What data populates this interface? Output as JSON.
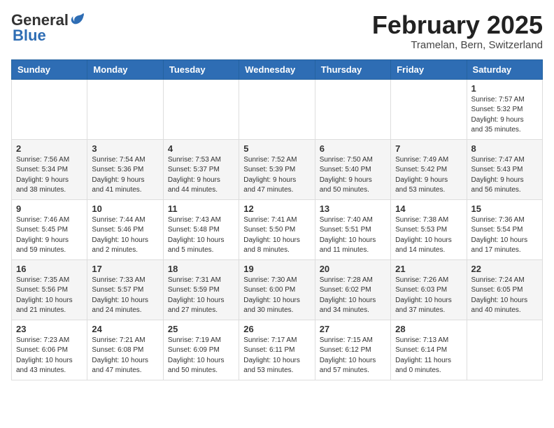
{
  "header": {
    "logo_general": "General",
    "logo_blue": "Blue",
    "month_title": "February 2025",
    "location": "Tramelan, Bern, Switzerland"
  },
  "weekdays": [
    "Sunday",
    "Monday",
    "Tuesday",
    "Wednesday",
    "Thursday",
    "Friday",
    "Saturday"
  ],
  "weeks": [
    [
      {
        "day": "",
        "info": ""
      },
      {
        "day": "",
        "info": ""
      },
      {
        "day": "",
        "info": ""
      },
      {
        "day": "",
        "info": ""
      },
      {
        "day": "",
        "info": ""
      },
      {
        "day": "",
        "info": ""
      },
      {
        "day": "1",
        "info": "Sunrise: 7:57 AM\nSunset: 5:32 PM\nDaylight: 9 hours\nand 35 minutes."
      }
    ],
    [
      {
        "day": "2",
        "info": "Sunrise: 7:56 AM\nSunset: 5:34 PM\nDaylight: 9 hours\nand 38 minutes."
      },
      {
        "day": "3",
        "info": "Sunrise: 7:54 AM\nSunset: 5:36 PM\nDaylight: 9 hours\nand 41 minutes."
      },
      {
        "day": "4",
        "info": "Sunrise: 7:53 AM\nSunset: 5:37 PM\nDaylight: 9 hours\nand 44 minutes."
      },
      {
        "day": "5",
        "info": "Sunrise: 7:52 AM\nSunset: 5:39 PM\nDaylight: 9 hours\nand 47 minutes."
      },
      {
        "day": "6",
        "info": "Sunrise: 7:50 AM\nSunset: 5:40 PM\nDaylight: 9 hours\nand 50 minutes."
      },
      {
        "day": "7",
        "info": "Sunrise: 7:49 AM\nSunset: 5:42 PM\nDaylight: 9 hours\nand 53 minutes."
      },
      {
        "day": "8",
        "info": "Sunrise: 7:47 AM\nSunset: 5:43 PM\nDaylight: 9 hours\nand 56 minutes."
      }
    ],
    [
      {
        "day": "9",
        "info": "Sunrise: 7:46 AM\nSunset: 5:45 PM\nDaylight: 9 hours\nand 59 minutes."
      },
      {
        "day": "10",
        "info": "Sunrise: 7:44 AM\nSunset: 5:46 PM\nDaylight: 10 hours\nand 2 minutes."
      },
      {
        "day": "11",
        "info": "Sunrise: 7:43 AM\nSunset: 5:48 PM\nDaylight: 10 hours\nand 5 minutes."
      },
      {
        "day": "12",
        "info": "Sunrise: 7:41 AM\nSunset: 5:50 PM\nDaylight: 10 hours\nand 8 minutes."
      },
      {
        "day": "13",
        "info": "Sunrise: 7:40 AM\nSunset: 5:51 PM\nDaylight: 10 hours\nand 11 minutes."
      },
      {
        "day": "14",
        "info": "Sunrise: 7:38 AM\nSunset: 5:53 PM\nDaylight: 10 hours\nand 14 minutes."
      },
      {
        "day": "15",
        "info": "Sunrise: 7:36 AM\nSunset: 5:54 PM\nDaylight: 10 hours\nand 17 minutes."
      }
    ],
    [
      {
        "day": "16",
        "info": "Sunrise: 7:35 AM\nSunset: 5:56 PM\nDaylight: 10 hours\nand 21 minutes."
      },
      {
        "day": "17",
        "info": "Sunrise: 7:33 AM\nSunset: 5:57 PM\nDaylight: 10 hours\nand 24 minutes."
      },
      {
        "day": "18",
        "info": "Sunrise: 7:31 AM\nSunset: 5:59 PM\nDaylight: 10 hours\nand 27 minutes."
      },
      {
        "day": "19",
        "info": "Sunrise: 7:30 AM\nSunset: 6:00 PM\nDaylight: 10 hours\nand 30 minutes."
      },
      {
        "day": "20",
        "info": "Sunrise: 7:28 AM\nSunset: 6:02 PM\nDaylight: 10 hours\nand 34 minutes."
      },
      {
        "day": "21",
        "info": "Sunrise: 7:26 AM\nSunset: 6:03 PM\nDaylight: 10 hours\nand 37 minutes."
      },
      {
        "day": "22",
        "info": "Sunrise: 7:24 AM\nSunset: 6:05 PM\nDaylight: 10 hours\nand 40 minutes."
      }
    ],
    [
      {
        "day": "23",
        "info": "Sunrise: 7:23 AM\nSunset: 6:06 PM\nDaylight: 10 hours\nand 43 minutes."
      },
      {
        "day": "24",
        "info": "Sunrise: 7:21 AM\nSunset: 6:08 PM\nDaylight: 10 hours\nand 47 minutes."
      },
      {
        "day": "25",
        "info": "Sunrise: 7:19 AM\nSunset: 6:09 PM\nDaylight: 10 hours\nand 50 minutes."
      },
      {
        "day": "26",
        "info": "Sunrise: 7:17 AM\nSunset: 6:11 PM\nDaylight: 10 hours\nand 53 minutes."
      },
      {
        "day": "27",
        "info": "Sunrise: 7:15 AM\nSunset: 6:12 PM\nDaylight: 10 hours\nand 57 minutes."
      },
      {
        "day": "28",
        "info": "Sunrise: 7:13 AM\nSunset: 6:14 PM\nDaylight: 11 hours\nand 0 minutes."
      },
      {
        "day": "",
        "info": ""
      }
    ]
  ]
}
